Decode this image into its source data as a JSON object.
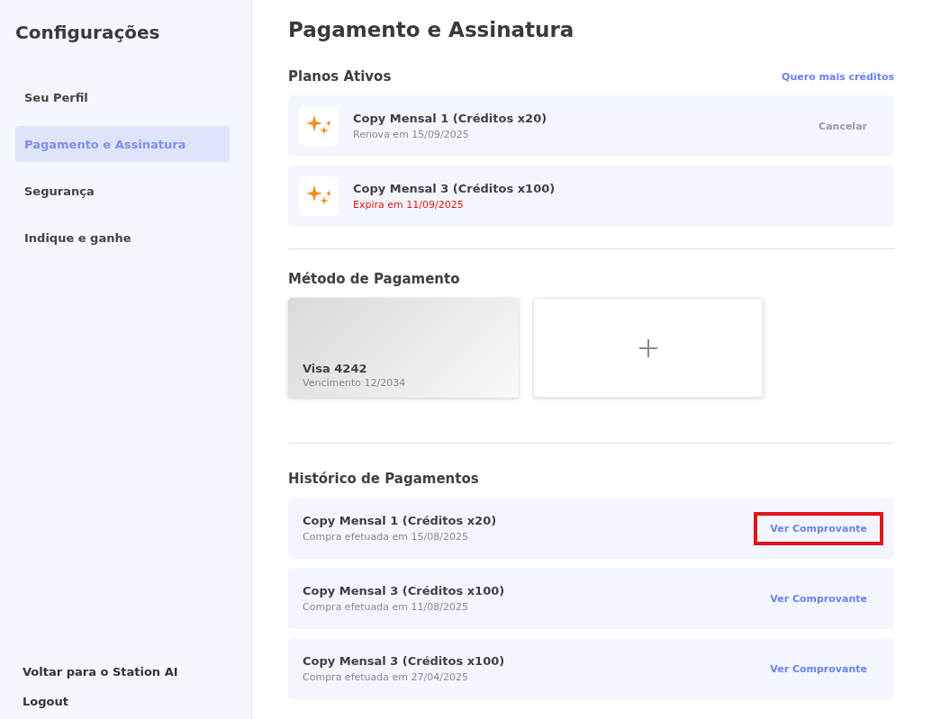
{
  "sidebar": {
    "title": "Configurações",
    "items": [
      {
        "label": "Seu Perfil",
        "selected": false
      },
      {
        "label": "Pagamento e Assinatura",
        "selected": true
      },
      {
        "label": "Segurança",
        "selected": false
      },
      {
        "label": "Indique e ganhe",
        "selected": false
      }
    ],
    "footer_links": [
      "Voltar para o Station AI",
      "Logout"
    ]
  },
  "page_title": "Pagamento e Assinatura",
  "active_plans": {
    "heading": "Planos Ativos",
    "link": "Quero mais créditos",
    "plans": [
      {
        "name": "Copy Mensal 1 (Créditos x20)",
        "status": "Renova em 15/09/2025",
        "warning": false,
        "action": "Cancelar",
        "action_disabled": true
      },
      {
        "name": "Copy Mensal 3 (Créditos x100)",
        "status": "Expira em 11/09/2025",
        "warning": true
      }
    ]
  },
  "payment_method": {
    "heading": "Método de Pagamento",
    "cards": [
      {
        "brand": "Visa 4242",
        "expiry": "Vencimento 12/2034"
      }
    ]
  },
  "history": {
    "heading": "Histórico de Pagamentos",
    "entries": [
      {
        "name": "Copy Mensal 1 (Créditos x20)",
        "date": "Compra efetuada em 15/08/2025",
        "action": "Ver Comprovante",
        "highlighted": true
      },
      {
        "name": "Copy Mensal 3 (Créditos x100)",
        "date": "Compra efetuada em 11/08/2025",
        "action": "Ver Comprovante",
        "highlighted": false
      },
      {
        "name": "Copy Mensal 3 (Créditos x100)",
        "date": "Compra efetuada em 27/04/2025",
        "action": "Ver Comprovante",
        "highlighted": false
      }
    ]
  }
}
